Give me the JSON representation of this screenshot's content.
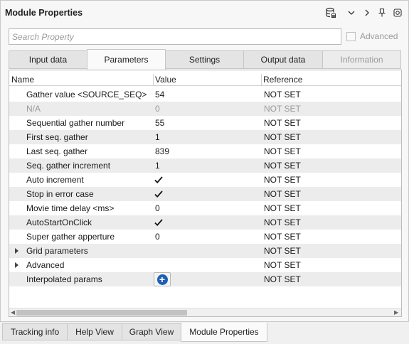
{
  "panel": {
    "title": "Module Properties"
  },
  "search": {
    "placeholder": "Search Property",
    "value": ""
  },
  "advanced": {
    "label": "Advanced",
    "checked": false
  },
  "tabs": [
    {
      "label": "Input data",
      "active": false,
      "enabled": true
    },
    {
      "label": "Parameters",
      "active": true,
      "enabled": true
    },
    {
      "label": "Settings",
      "active": false,
      "enabled": true
    },
    {
      "label": "Output data",
      "active": false,
      "enabled": true
    },
    {
      "label": "Information",
      "active": false,
      "enabled": false
    }
  ],
  "grid": {
    "columns": [
      "Name",
      "Value",
      "Reference"
    ],
    "rows": [
      {
        "name": "Gather value <SOURCE_SEQ>",
        "value": "54",
        "reference": "NOT SET"
      },
      {
        "name": "N/A",
        "value": "0",
        "reference": "NOT SET",
        "disabled": true
      },
      {
        "name": "Sequential gather number",
        "value": "55",
        "reference": "NOT SET"
      },
      {
        "name": "First seq. gather",
        "value": "1",
        "reference": "NOT SET"
      },
      {
        "name": "Last seq. gather",
        "value": "839",
        "reference": "NOT SET"
      },
      {
        "name": "Seq. gather increment",
        "value": "1",
        "reference": "NOT SET"
      },
      {
        "name": "Auto increment",
        "value": "",
        "checkbox": true,
        "reference": "NOT SET"
      },
      {
        "name": "Stop in error case",
        "value": "",
        "checkbox": true,
        "reference": "NOT SET"
      },
      {
        "name": "Movie time delay <ms>",
        "value": "0",
        "reference": "NOT SET"
      },
      {
        "name": "AutoStartOnClick",
        "value": "",
        "checkbox": true,
        "reference": "NOT SET"
      },
      {
        "name": "Super gather apperture",
        "value": "0",
        "reference": "NOT SET"
      },
      {
        "name": "Grid parameters",
        "value": "",
        "expandable": true,
        "reference": "NOT SET"
      },
      {
        "name": "Advanced",
        "value": "",
        "expandable": true,
        "reference": "NOT SET"
      },
      {
        "name": "Interpolated params",
        "value": "",
        "addButton": true,
        "reference": "NOT SET"
      }
    ]
  },
  "bottom_tabs": [
    {
      "label": "Tracking info",
      "active": false
    },
    {
      "label": "Help View",
      "active": false
    },
    {
      "label": "Graph View",
      "active": false
    },
    {
      "label": "Module Properties",
      "active": true
    }
  ],
  "icons": {
    "database": "database-icon",
    "chevron_down": "chevron-down-icon",
    "chevron_right": "chevron-right-icon",
    "pin": "pin-icon",
    "maximize": "maximize-icon"
  }
}
